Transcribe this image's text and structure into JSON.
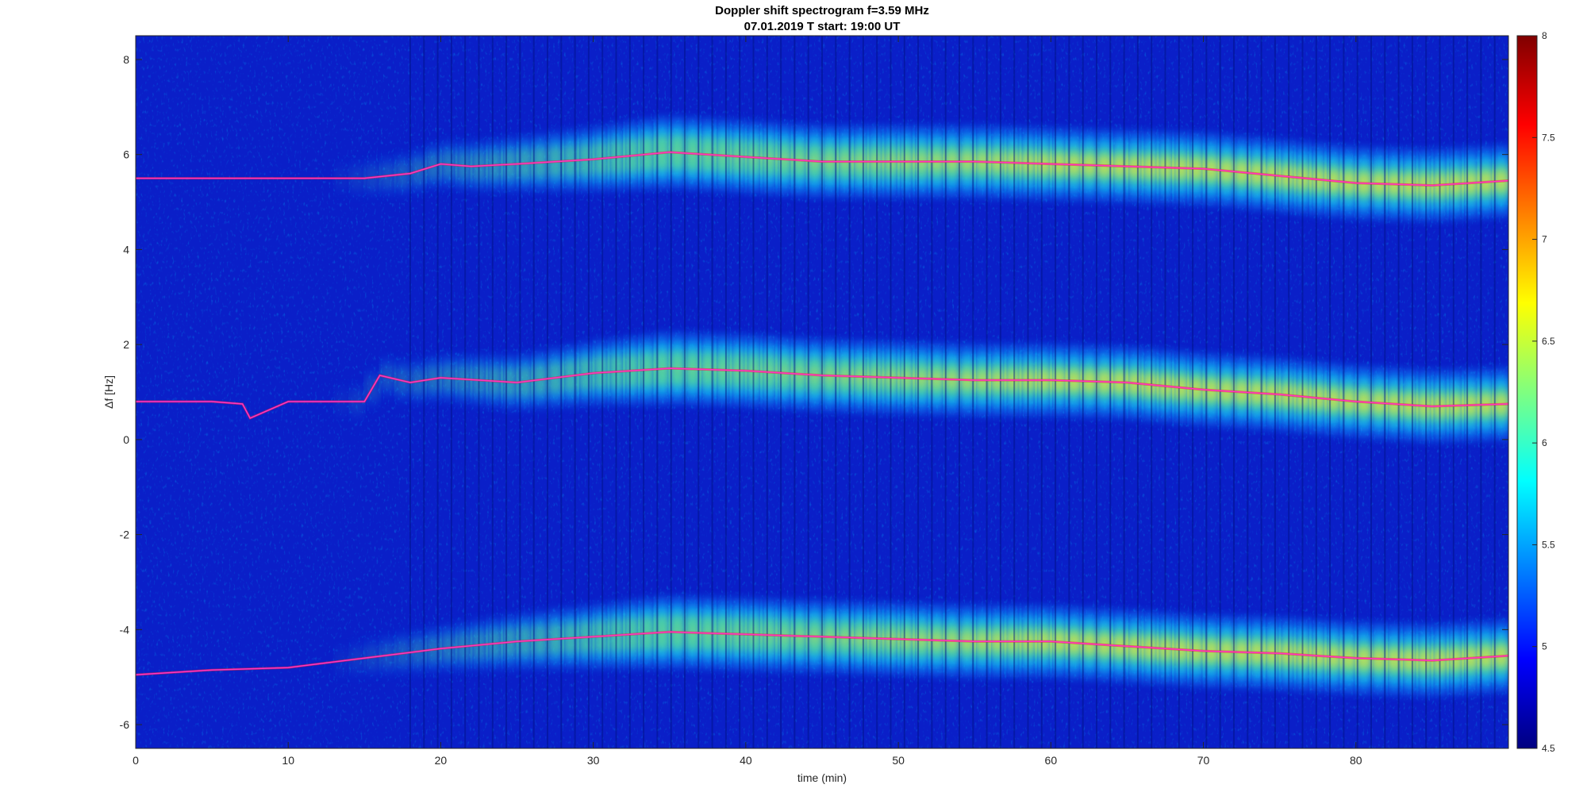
{
  "chart_data": {
    "type": "heatmap",
    "title": "Doppler shift spectrogram f=3.59 MHz",
    "subtitle": "07.01.2019   T start: 19:00 UT",
    "xlabel": "time (min)",
    "ylabel": "Δf [Hz]",
    "xlim": [
      0,
      90
    ],
    "ylim": [
      -6.5,
      8.5
    ],
    "xticks": [
      0,
      10,
      20,
      30,
      40,
      50,
      60,
      70,
      80
    ],
    "yticks": [
      -6,
      -4,
      -2,
      0,
      2,
      4,
      6,
      8
    ],
    "colorbar": {
      "min": 4.5,
      "max": 8,
      "ticks": [
        4.5,
        5,
        5.5,
        6,
        6.5,
        7,
        7.5,
        8
      ],
      "colormap": "jet"
    },
    "traces_color": "#ff33cc",
    "bands": [
      {
        "name": "",
        "time": [
          0,
          10,
          15,
          18,
          20,
          22,
          25,
          30,
          35,
          40,
          45,
          50,
          55,
          60,
          65,
          70,
          75,
          80,
          85,
          90
        ],
        "freq": [
          5.5,
          5.5,
          5.5,
          5.6,
          5.8,
          5.75,
          5.8,
          5.9,
          6.05,
          5.95,
          5.85,
          5.85,
          5.85,
          5.8,
          5.75,
          5.7,
          5.55,
          5.4,
          5.35,
          5.45
        ]
      },
      {
        "name": "",
        "time": [
          0,
          5,
          7,
          7.5,
          10,
          15,
          16,
          18,
          20,
          25,
          30,
          35,
          40,
          45,
          50,
          55,
          60,
          65,
          70,
          75,
          80,
          85,
          90
        ],
        "freq": [
          0.8,
          0.8,
          0.75,
          0.45,
          0.8,
          0.8,
          1.35,
          1.2,
          1.3,
          1.2,
          1.4,
          1.5,
          1.45,
          1.35,
          1.3,
          1.25,
          1.25,
          1.2,
          1.05,
          0.95,
          0.8,
          0.7,
          0.75
        ]
      },
      {
        "name": "",
        "time": [
          0,
          5,
          10,
          15,
          20,
          25,
          30,
          35,
          40,
          45,
          50,
          55,
          60,
          65,
          70,
          75,
          80,
          85,
          90
        ],
        "freq": [
          -4.95,
          -4.85,
          -4.8,
          -4.6,
          -4.4,
          -4.25,
          -4.15,
          -4.05,
          -4.1,
          -4.15,
          -4.2,
          -4.25,
          -4.25,
          -4.35,
          -4.45,
          -4.5,
          -4.6,
          -4.65,
          -4.55
        ]
      }
    ]
  }
}
